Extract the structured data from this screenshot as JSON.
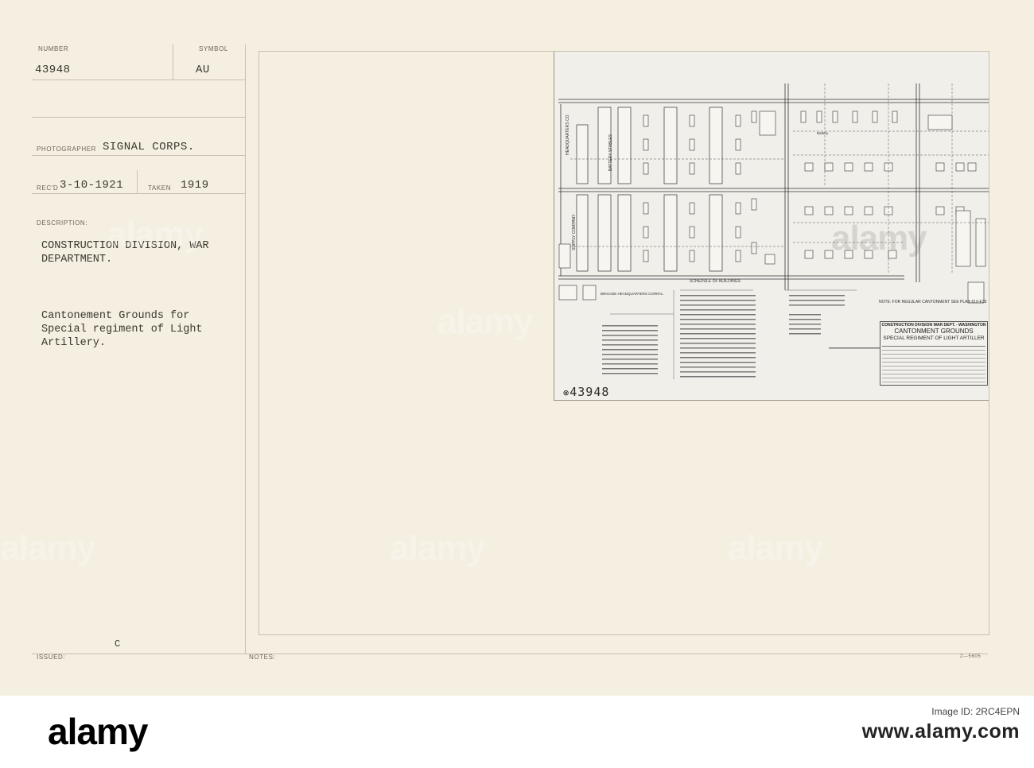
{
  "card": {
    "number_label": "NUMBER",
    "number_value": "43948",
    "symbol_label": "SYMBOL",
    "symbol_value": "AU",
    "photographer_label": "PHOTOGRAPHER",
    "photographer_value": "SIGNAL CORPS.",
    "recd_label": "REC'D",
    "recd_value": "3-10-1921",
    "taken_label": "TAKEN",
    "taken_value": "1919",
    "description_label": "DESCRIPTION:",
    "description_line1": "CONSTRUCTION DIVISION, WAR",
    "description_line2": "DEPARTMENT.",
    "caption_line1": "Cantonement Grounds for",
    "caption_line2": "Special regiment of Light",
    "caption_line3": "Artillery.",
    "issued_label": "ISSUED:",
    "issued_value": "C",
    "notes_label": "NOTES:",
    "form_number": "2—5605"
  },
  "photo": {
    "handwritten_number": "43948",
    "title_block_header": "CONSTRUCTION DIVISION WAR DEPT. - WASHINGTON",
    "title_block_title1": "CANTONMENT GROUNDS",
    "title_block_title2": "SPECIAL REGIMENT OF LIGHT ARTILLER",
    "schedule_heading": "SCHEDULE OF BUILDINGS",
    "note_text": "NOTE: FOR REGULAR CANTONMENT SEE PLAN 610-E35",
    "stables_label": "BATTERY STABLES",
    "headquarters_label": "HEADQUARTERS CO.",
    "supply_label": "SUPPLY COMPANY",
    "brigade_label": "BRIGADE HEADQUARTERS CORRAL",
    "battery_label": "Battery"
  },
  "watermark": {
    "text": "alamy"
  },
  "footer": {
    "logo": "alamy",
    "image_id_label": "Image ID: 2RC4EPN",
    "url": "www.alamy.com"
  }
}
